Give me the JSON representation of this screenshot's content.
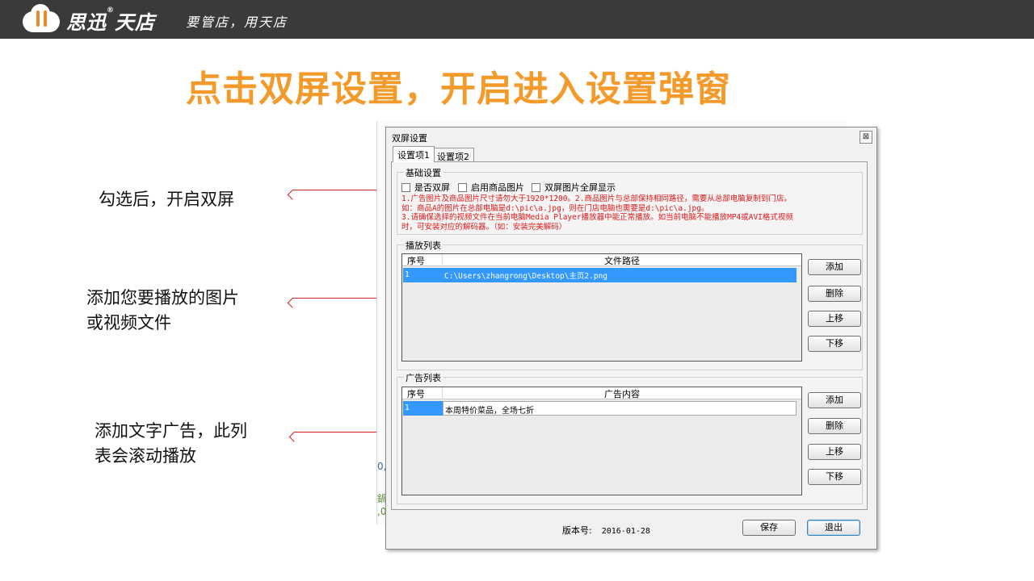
{
  "brand": {
    "name": "思迅",
    "reg_mark": "®",
    "name2": "天店",
    "slogan": "要管店，用天店"
  },
  "heading": "点击双屏设置，开启进入设置弹窗",
  "annotations": [
    {
      "lines": [
        "勾选后，开启双屏"
      ]
    },
    {
      "lines": [
        "添加您要播放的图片",
        "或视频文件"
      ]
    },
    {
      "lines": [
        "添加文字广告，此列",
        "表会滚动播放"
      ]
    }
  ],
  "background_app": {
    "ghost1": "0,",
    "ghost2": "鍋",
    "ghost3": ",0"
  },
  "dialog": {
    "title": "双屏设置",
    "close_glyph": "⊠",
    "tabs": [
      {
        "label": "设置项1",
        "active": true
      },
      {
        "label": "设置项2",
        "active": false
      }
    ],
    "basic": {
      "label": "基础设置",
      "checkboxes": [
        {
          "label": "是否双屏",
          "checked": false
        },
        {
          "label": "启用商品图片",
          "checked": false
        },
        {
          "label": "双屏图片全屏显示",
          "checked": false
        }
      ],
      "warnings": [
        "1.广告图片及商品图片尺寸请勿大于1920*1200。2.商品图片与总部保持相同路径，需要从总部电脑复制到门店。",
        "如：商品A的图片在总部电脑是d:\\pic\\a.jpg，则在门店电脑也需要是d:\\pic\\a.jpg。",
        "3.请确保选择的视频文件在当前电脑Media Player播放器中能正常播放。如当前电脑不能播放MP4或AVI格式视频",
        "时，可安装对应的解码器。（如：安装完美解码）"
      ]
    },
    "playlist": {
      "label": "播放列表",
      "columns": [
        "序号",
        "文件路径"
      ],
      "rows": [
        {
          "index": "1",
          "path": "C:\\Users\\zhangrong\\Desktop\\主页2.png"
        }
      ],
      "buttons": {
        "add": "添加",
        "delete": "删除",
        "up": "上移",
        "down": "下移"
      }
    },
    "adlist": {
      "label": "广告列表",
      "columns": [
        "序号",
        "广告内容"
      ],
      "rows": [
        {
          "index": "1",
          "content": "本周特价菜品，全场七折"
        }
      ],
      "buttons": {
        "add": "添加",
        "delete": "删除",
        "up": "上移",
        "down": "下移"
      }
    },
    "version": {
      "label": "版本号:",
      "value": "2016-01-28"
    },
    "save_label": "保存",
    "exit_label": "退出"
  },
  "colors": {
    "heading": "#f39a2a",
    "topbar": "#3a3a3a",
    "warning_text": "#e01818",
    "selection": "#3399ff",
    "arrow": "#d92020"
  }
}
